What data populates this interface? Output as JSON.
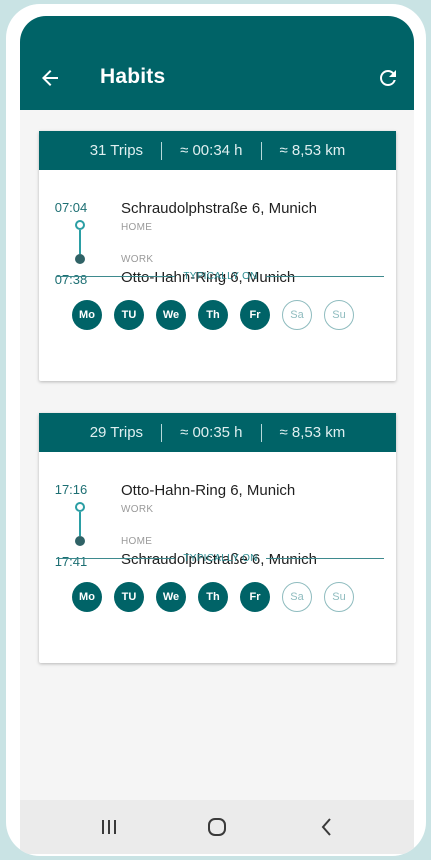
{
  "header": {
    "title": "Habits"
  },
  "icons": {
    "back": "arrow-back-icon",
    "refresh": "refresh-icon"
  },
  "colors": {
    "primary": "#006367",
    "accent": "#2b9ea4",
    "inactive_day": "#8fbcbf"
  },
  "typically_on_label": "TYPICALLY ON",
  "habits": [
    {
      "trips": "31 Trips",
      "duration": "≈ 00:34 h",
      "distance": "≈ 8,53 km",
      "start_time": "07:04",
      "end_time": "07:38",
      "from_address": "Schraudolphstraße 6, Munich",
      "from_tag": "HOME",
      "to_tag": "WORK",
      "to_address": "Otto-Hahn-Ring 6, Munich",
      "days": [
        {
          "label": "Mo",
          "active": true
        },
        {
          "label": "TU",
          "active": true
        },
        {
          "label": "We",
          "active": true
        },
        {
          "label": "Th",
          "active": true
        },
        {
          "label": "Fr",
          "active": true
        },
        {
          "label": "Sa",
          "active": false
        },
        {
          "label": "Su",
          "active": false
        }
      ]
    },
    {
      "trips": "29 Trips",
      "duration": "≈ 00:35 h",
      "distance": "≈ 8,53 km",
      "start_time": "17:16",
      "end_time": "17:41",
      "from_address": "Otto-Hahn-Ring 6, Munich",
      "from_tag": "WORK",
      "to_tag": "HOME",
      "to_address": "Schraudolphstraße 6, Munich",
      "days": [
        {
          "label": "Mo",
          "active": true
        },
        {
          "label": "TU",
          "active": true
        },
        {
          "label": "We",
          "active": true
        },
        {
          "label": "Th",
          "active": true
        },
        {
          "label": "Fr",
          "active": true
        },
        {
          "label": "Sa",
          "active": false
        },
        {
          "label": "Su",
          "active": false
        }
      ]
    }
  ],
  "navbar": {
    "recents": "recent-apps-icon",
    "home": "home-icon",
    "back": "nav-back-icon"
  }
}
